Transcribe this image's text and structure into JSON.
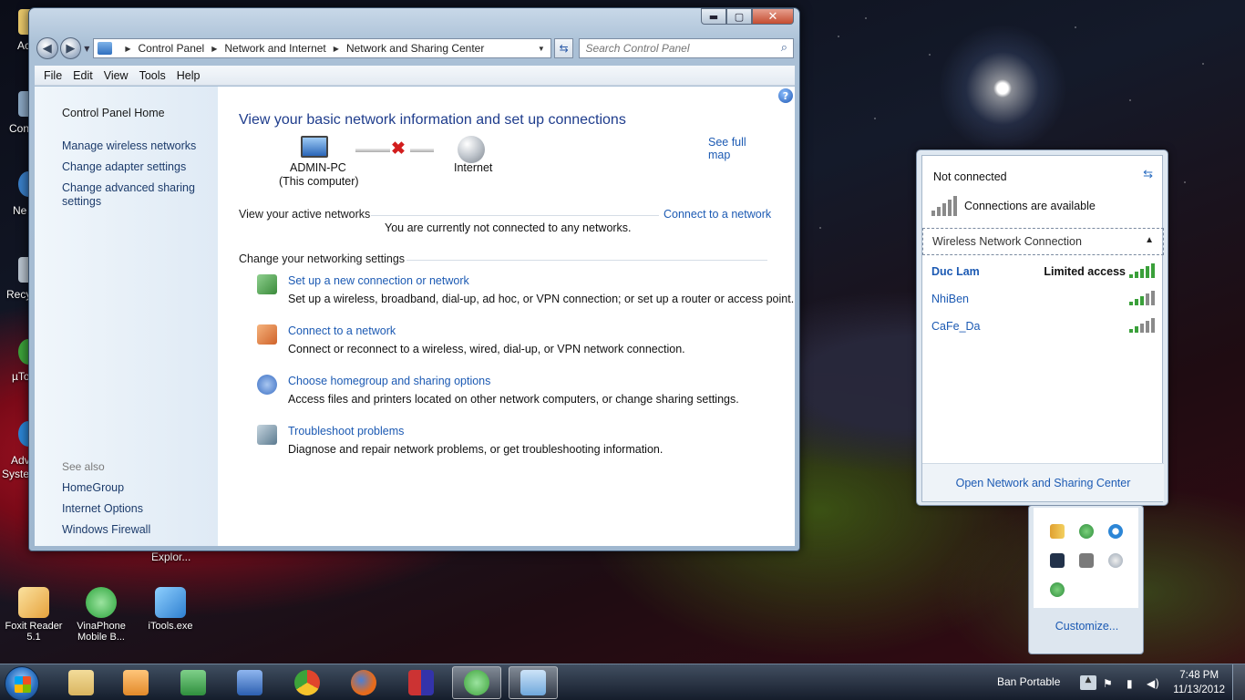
{
  "window": {
    "address": [
      "Control Panel",
      "Network and Internet",
      "Network and Sharing Center"
    ],
    "search_placeholder": "Search Control Panel",
    "caption": {
      "minimize": "▬",
      "maximize": "▢",
      "close": "✕"
    },
    "menu": [
      "File",
      "Edit",
      "View",
      "Tools",
      "Help"
    ],
    "left_pane": {
      "home": "Control Panel Home",
      "links": [
        "Manage wireless networks",
        "Change adapter settings",
        "Change advanced sharing settings"
      ],
      "see_also_label": "See also",
      "see_also": [
        "HomeGroup",
        "Internet Options",
        "Windows Firewall"
      ]
    },
    "main": {
      "title": "View your basic network information and set up connections",
      "see_full_map": "See full map",
      "computer_name": "ADMIN-PC",
      "computer_sub": "(This computer)",
      "internet": "Internet",
      "active_networks_label": "View your active networks",
      "connect_link": "Connect to a network",
      "not_connected_msg": "You are currently not connected to any networks.",
      "settings_label": "Change your networking settings",
      "tasks": [
        {
          "title": "Set up a new connection or network",
          "desc": "Set up a wireless, broadband, dial-up, ad hoc, or VPN connection; or set up a router or access point.",
          "color": "#3a8a3a"
        },
        {
          "title": "Connect to a network",
          "desc": "Connect or reconnect to a wireless, wired, dial-up, or VPN network connection.",
          "color": "#d0632a"
        },
        {
          "title": "Choose homegroup and sharing options",
          "desc": "Access files and printers located on other network computers, or change sharing settings.",
          "color": "#3b6fc4"
        },
        {
          "title": "Troubleshoot problems",
          "desc": "Diagnose and repair network problems, or get troubleshooting information.",
          "color": "#5b7a8f"
        }
      ]
    }
  },
  "flyout": {
    "status": "Not connected",
    "available": "Connections are available",
    "section": "Wireless Network Connection",
    "networks": [
      {
        "name": "Duc Lam",
        "status": "Limited access",
        "signal": 5
      },
      {
        "name": "NhiBen",
        "status": "",
        "signal": 3
      },
      {
        "name": "CaFe_Da",
        "status": "",
        "signal": 2
      }
    ],
    "footer": "Open Network and Sharing Center"
  },
  "tray_overflow": {
    "customize": "Customize..."
  },
  "desktop": {
    "icons": [
      {
        "label": "Foxit Reader 5.1",
        "color": "#e6a23c"
      },
      {
        "label": "VinaPhone Mobile B...",
        "color": "#2aa33a"
      },
      {
        "label": "iTools.exe",
        "color": "#2e7fd0"
      }
    ],
    "fragments": [
      "Ac",
      "Con",
      "Ne",
      "Recy",
      "µTo",
      "Adv",
      "Syste",
      "Explor..."
    ]
  },
  "taskbar": {
    "pinned_colors": [
      "#d9b560",
      "#e28a2a",
      "#2f8f3d",
      "#2c5fb0",
      "#e0452c",
      "#e66b1c",
      "#6b6b6b",
      "#3da33a",
      "#6fa8dc"
    ],
    "tray_label": "Ban Portable",
    "time": "7:48 PM",
    "date": "11/13/2012"
  },
  "colors": {
    "link": "#1c5ab3",
    "title": "#1e3c8c"
  }
}
